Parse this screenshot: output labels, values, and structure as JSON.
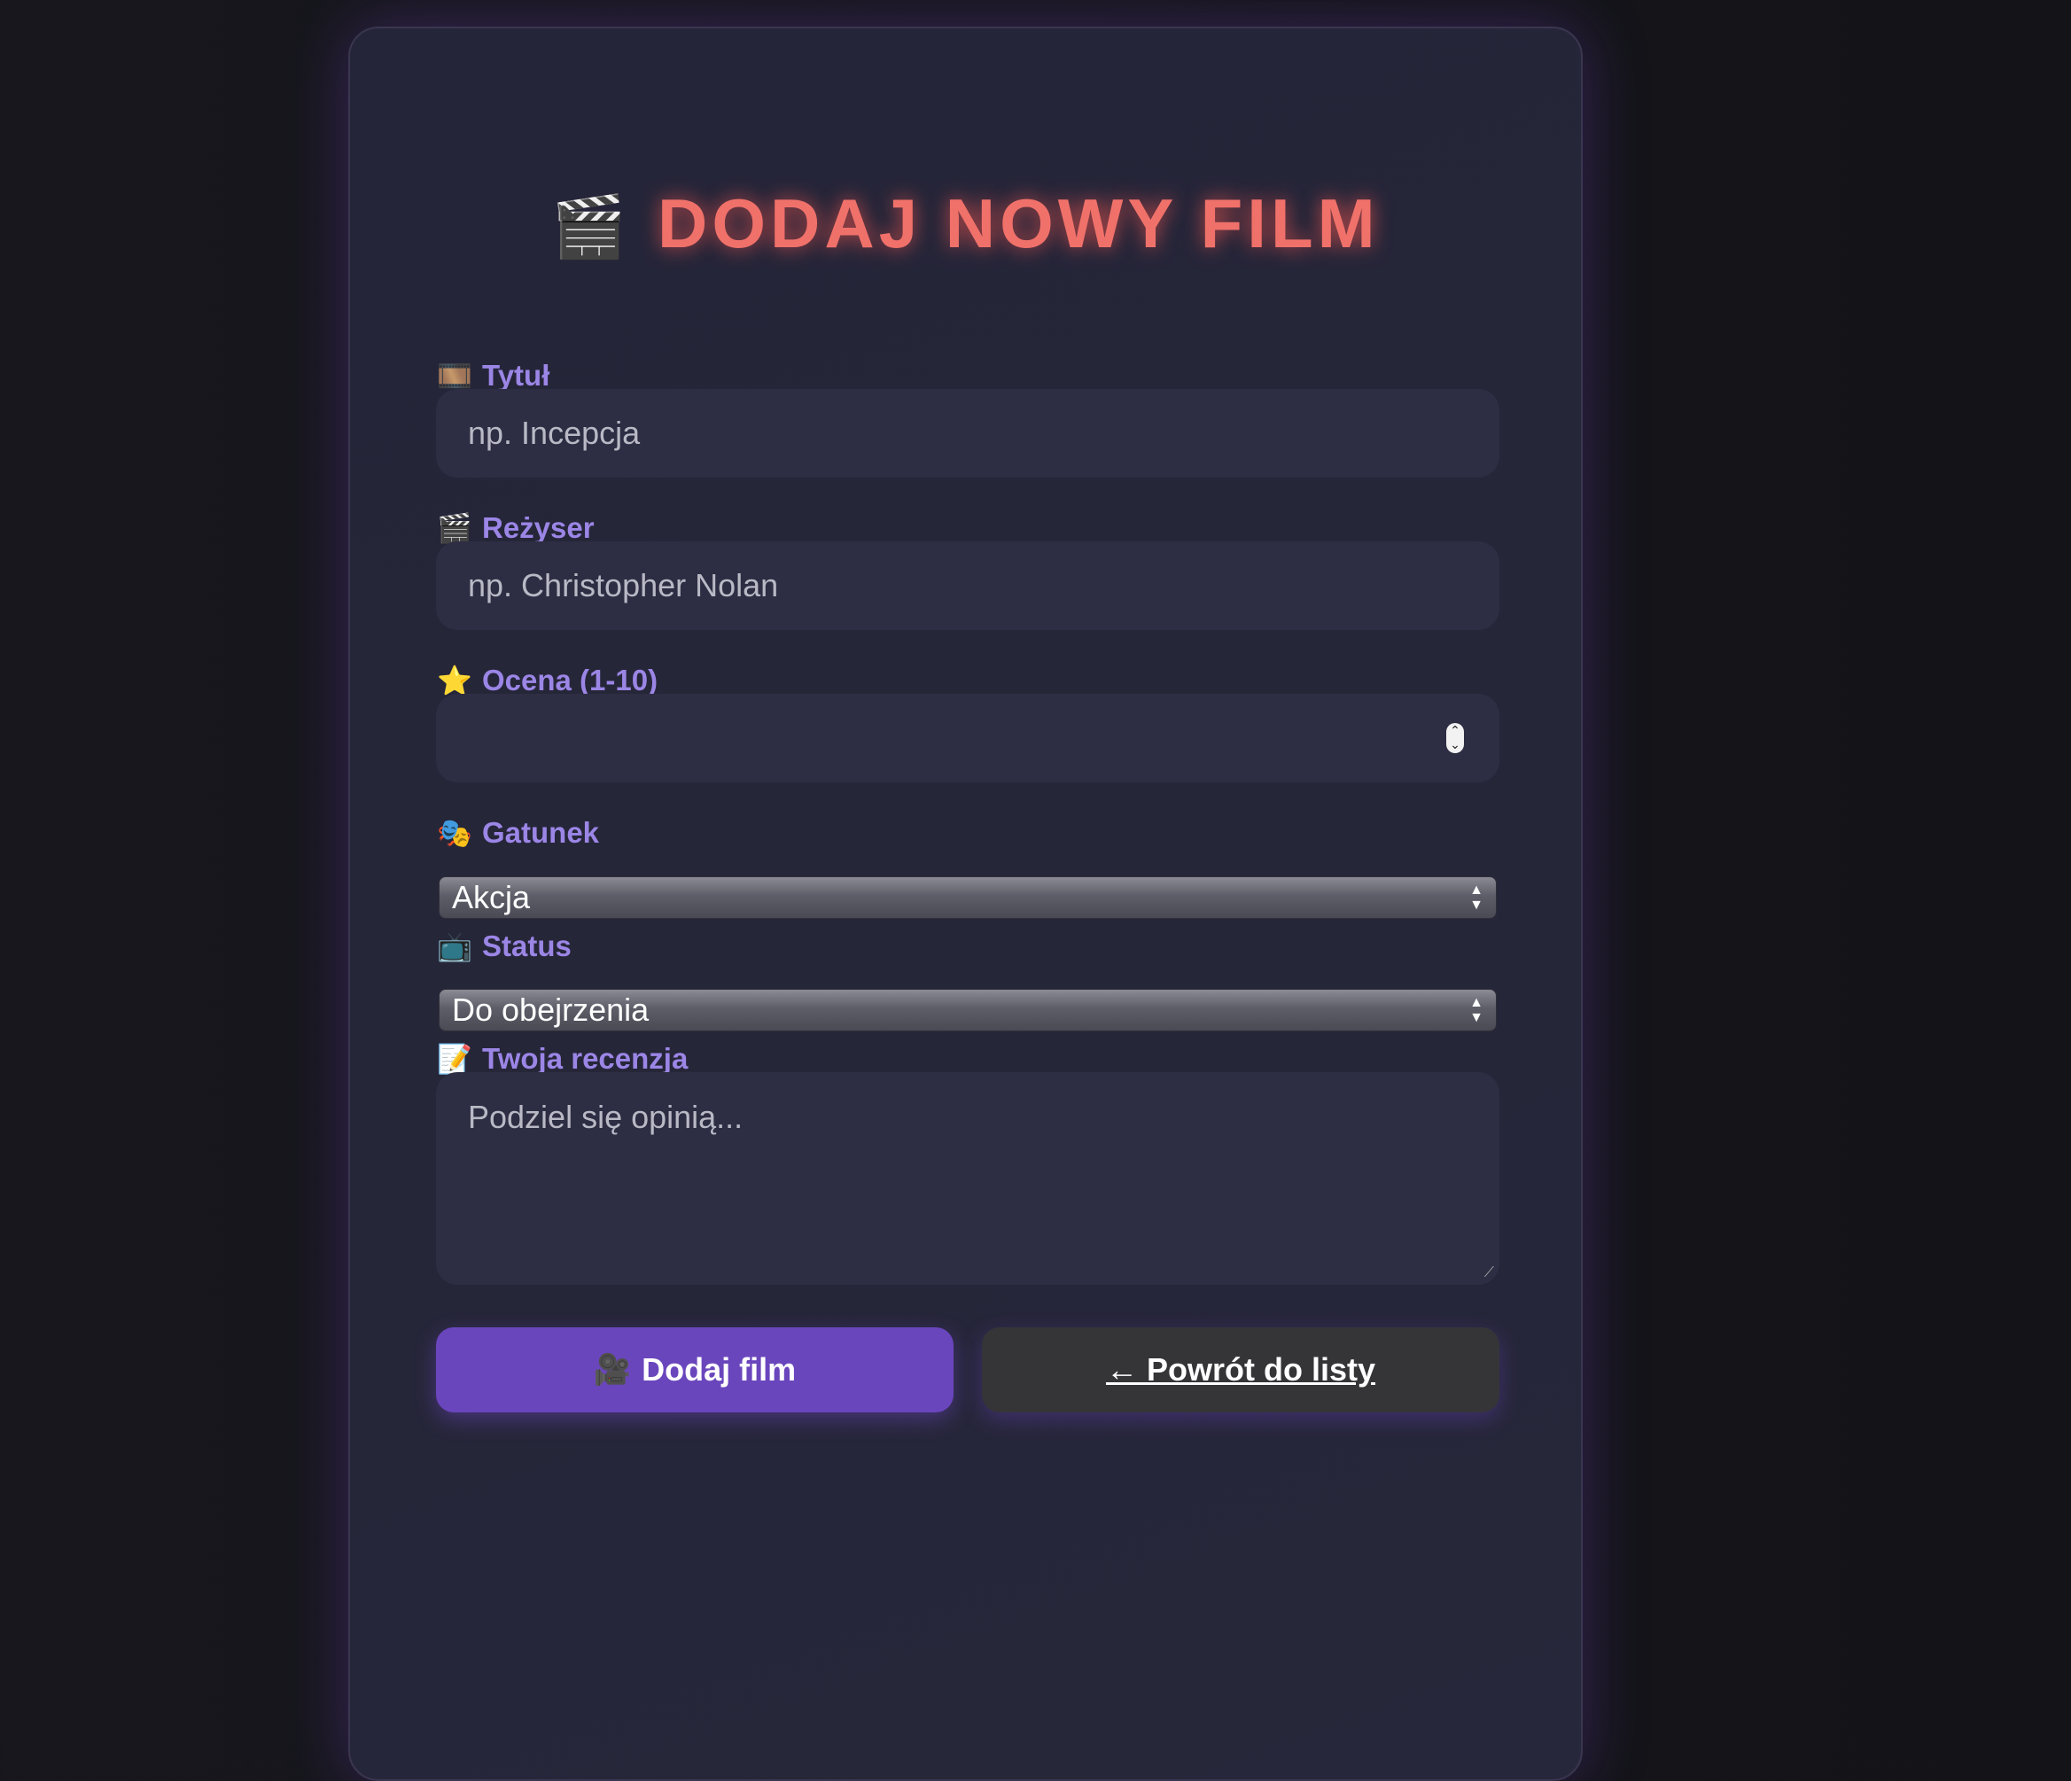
{
  "header": {
    "title_icon": "🎬",
    "title": "DODAJ NOWY FILM"
  },
  "form": {
    "title": {
      "icon": "🎞️",
      "label": "Tytuł",
      "placeholder": "np. Incepcja"
    },
    "director": {
      "icon": "🎬",
      "label": "Reżyser",
      "placeholder": "np. Christopher Nolan"
    },
    "rating": {
      "icon": "⭐",
      "label": "Ocena (1-10)",
      "value": ""
    },
    "genre": {
      "icon": "🎭",
      "label": "Gatunek",
      "selected": "Akcja"
    },
    "status": {
      "icon": "📺",
      "label": "Status",
      "selected": "Do obejrzenia"
    },
    "review": {
      "icon": "📝",
      "label": "Twoja recenzja",
      "placeholder": "Podziel się opinią..."
    }
  },
  "actions": {
    "submit_icon": "🎥",
    "submit_label": "Dodaj film",
    "back_label": "← Powrót do listy"
  }
}
